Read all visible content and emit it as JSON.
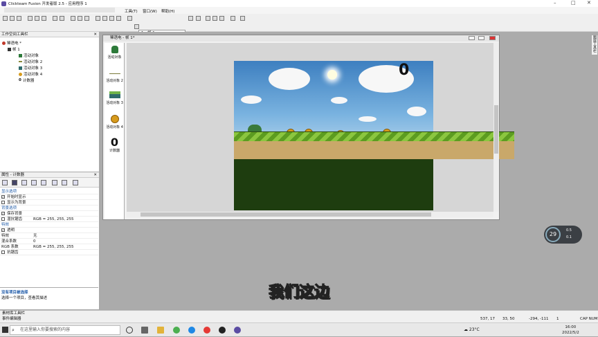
{
  "titlebar": {
    "title": "Clickteam Fusion 开发者版 2.5 - 应用程序 1",
    "minimize": "–",
    "maximize": "□",
    "close": "✕"
  },
  "menu": [
    "工具(T)",
    "窗口(W)",
    "帮助(H)"
  ],
  "toolbar": {
    "frame_select": "1 - 帧 1"
  },
  "workspace": {
    "title": "工作空间工具栏",
    "tree": {
      "app": "稀语电 *",
      "frame": "帧 1",
      "objects": [
        "活动对象",
        "活动对象 2",
        "活动对象 3",
        "活动对象 4",
        "计数器"
      ]
    }
  },
  "properties": {
    "title": "属性 - 计数器",
    "rows": [
      {
        "label": "显示选项",
        "section": true
      },
      {
        "label": "开始时显示",
        "check": "✓"
      },
      {
        "label": "显示为背景",
        "check": ""
      },
      {
        "label": "背景选项",
        "section": true
      },
      {
        "label": "保存背景",
        "check": "✓"
      },
      {
        "label": "湿抗锯齿",
        "check": "",
        "value": "RGB = 255, 255, 255"
      },
      {
        "label": "特效",
        "section": true
      },
      {
        "label": "透明",
        "check": "✓"
      },
      {
        "label": "特效",
        "value": "无"
      },
      {
        "label": "混合系数",
        "value": "0"
      },
      {
        "label": "RGB 系数",
        "value": "RGB = 255, 255, 255"
      },
      {
        "label": "抗锯齿",
        "check": ""
      }
    ],
    "desc_title": "没有项目被选择",
    "desc_text": "选择一个项目，查看其描述"
  },
  "frame_window": {
    "title": "稀语电 - 帧 1*",
    "library": [
      {
        "label": "活动对象",
        "icon": "dragon-icon"
      },
      {
        "label": "活动对象 2",
        "icon": "line-icon"
      },
      {
        "label": "活动对象 3",
        "icon": "ground-icon"
      },
      {
        "label": "活动对象 4",
        "icon": "coin-icon"
      },
      {
        "label": "计数器",
        "icon": "counter-icon",
        "glyph": "0"
      }
    ],
    "counter_value": "0"
  },
  "right_tab": "图层工具栏",
  "subtitle": "我们这边",
  "network": {
    "percent": "29",
    "up": "0.5",
    "down": "0.1"
  },
  "bottom_tab": "素材库工具栏",
  "status": {
    "left": "事件编辑器",
    "coords1": "537, 17",
    "coords2": "33, 50",
    "coords3": "-294, -111",
    "page": "1",
    "caps": "CAP NUM"
  },
  "taskbar": {
    "search_placeholder": "在这里输入你要搜索的内容",
    "weather": "23°C",
    "time": "16:00",
    "date": "2022/5/2"
  }
}
